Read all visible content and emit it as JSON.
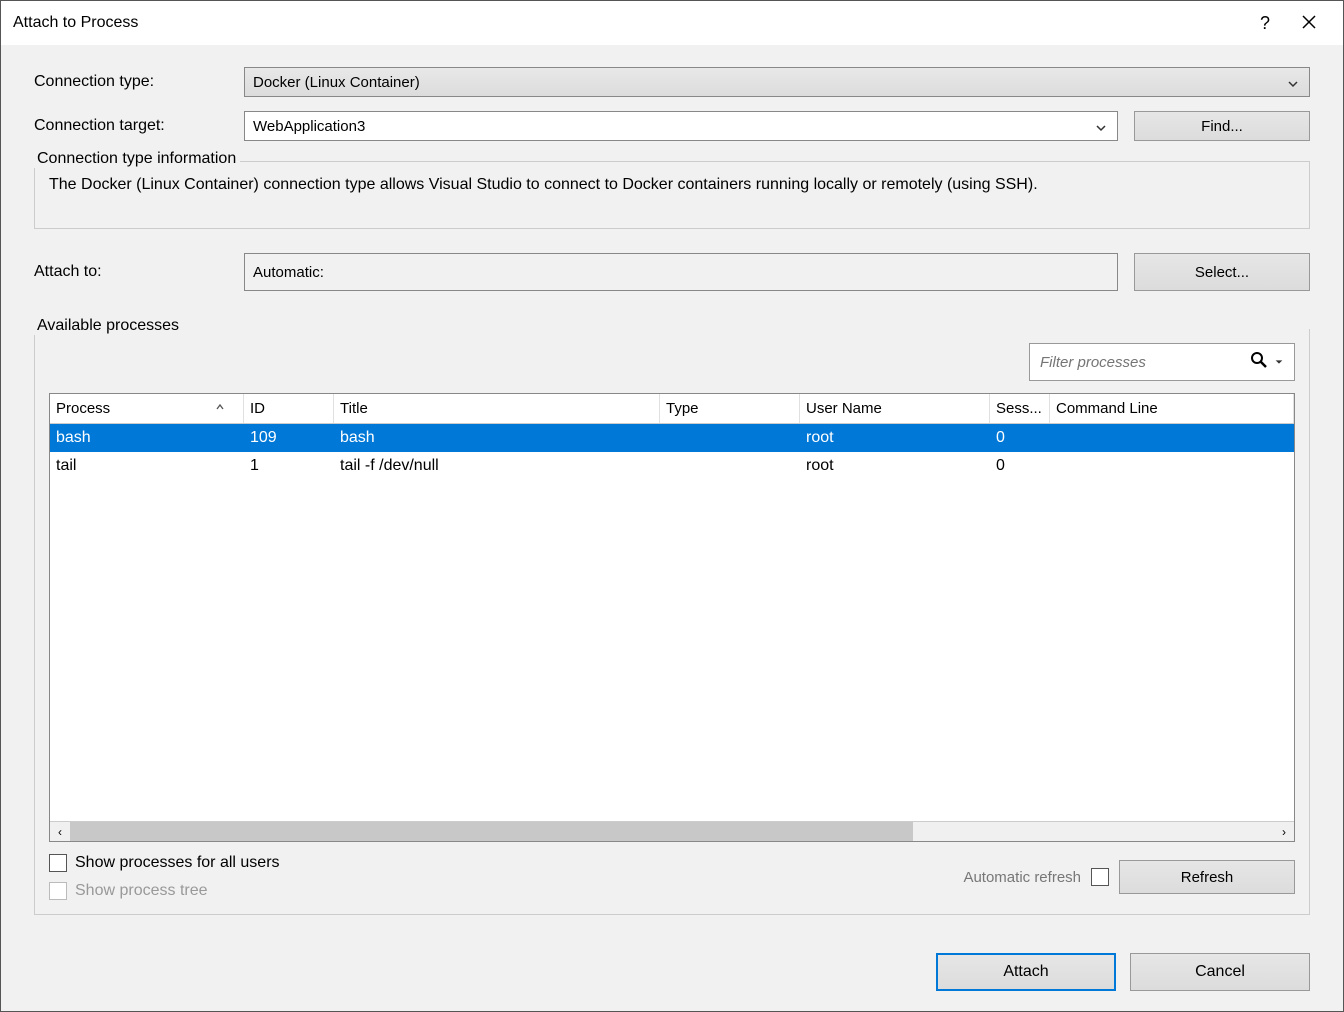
{
  "window": {
    "title": "Attach to Process",
    "help": "?",
    "close": "×"
  },
  "form": {
    "conn_type_label": "Connection type:",
    "conn_type_value": "Docker (Linux Container)",
    "conn_target_label": "Connection target:",
    "conn_target_value": "WebApplication3",
    "find_button": "Find...",
    "info_header": "Connection type information",
    "info_text": "The Docker (Linux Container) connection type allows Visual Studio to connect to Docker containers running locally or remotely (using SSH).",
    "attach_to_label": "Attach to:",
    "attach_to_value": "Automatic:",
    "select_button": "Select..."
  },
  "processes": {
    "section_label": "Available processes",
    "filter_placeholder": "Filter processes",
    "columns": {
      "process": "Process",
      "id": "ID",
      "title": "Title",
      "type": "Type",
      "user": "User Name",
      "session": "Sess...",
      "cmd": "Command Line"
    },
    "rows": [
      {
        "process": "bash",
        "id": "109",
        "title": "bash",
        "type": "",
        "user": "root",
        "session": "0",
        "cmd": "",
        "selected": true
      },
      {
        "process": "tail",
        "id": "1",
        "title": "tail -f /dev/null",
        "type": "",
        "user": "root",
        "session": "0",
        "cmd": "",
        "selected": false
      }
    ],
    "show_all_users": "Show processes for all users",
    "show_tree": "Show process tree",
    "auto_refresh": "Automatic refresh",
    "refresh_button": "Refresh"
  },
  "footer": {
    "attach": "Attach",
    "cancel": "Cancel"
  }
}
